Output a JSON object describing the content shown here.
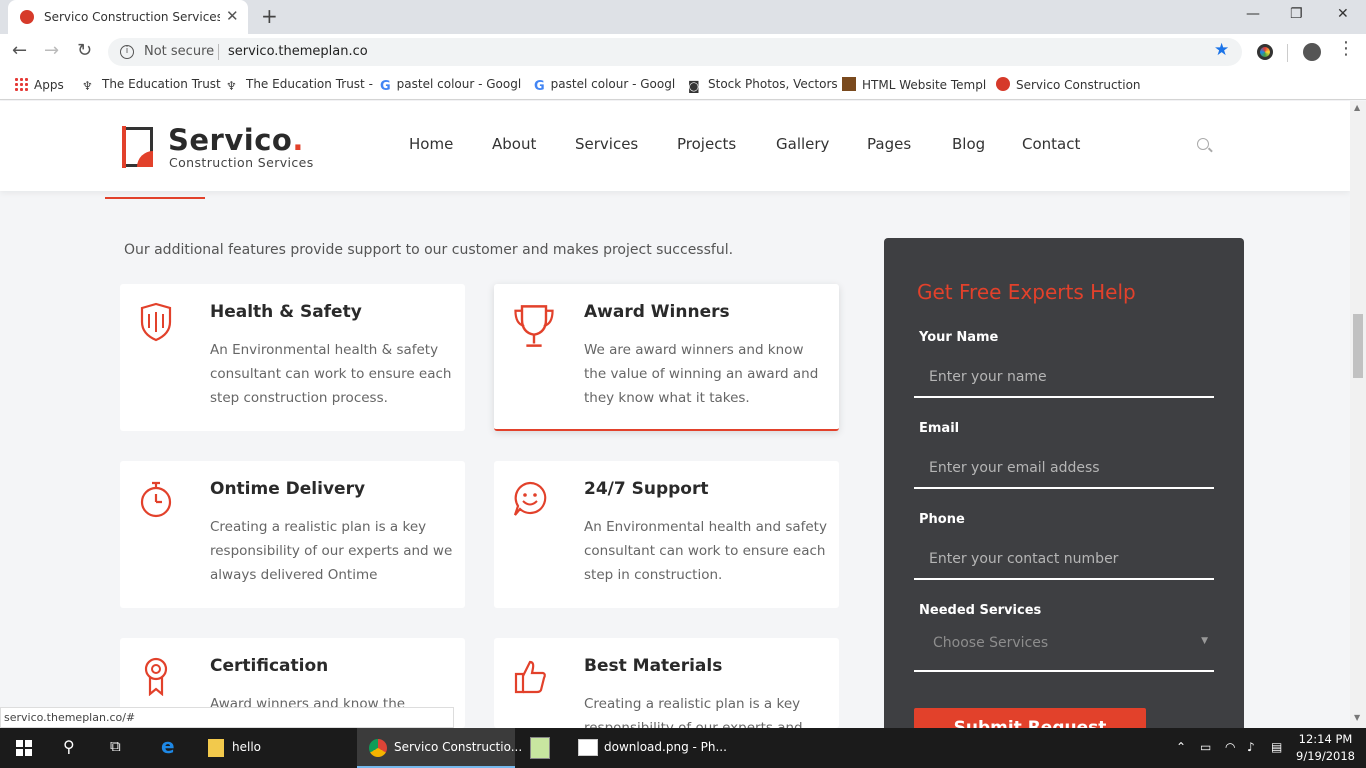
{
  "browser": {
    "tab_title": "Servico Construction Services Bo",
    "url": "servico.themeplan.co",
    "security_label": "Not secure",
    "bookmarks": [
      "Apps",
      "The Education Trust",
      "The Education Trust -",
      "pastel colour - Googl",
      "pastel colour - Googl",
      "Stock Photos, Vectors",
      "HTML Website Templ",
      "Servico Construction"
    ],
    "status_url": "servico.themeplan.co/#"
  },
  "site": {
    "logo_name": "Servico",
    "logo_dot": ".",
    "logo_sub": "Construction Services",
    "nav": [
      "Home",
      "About",
      "Services",
      "Projects",
      "Gallery",
      "Pages",
      "Blog",
      "Contact"
    ],
    "accent_color": "#e2412b"
  },
  "features": {
    "intro": "Our additional features provide support to our customer and makes project successful.",
    "cards": [
      {
        "title": "Health & Safety",
        "text": "An Environmental health & safety consultant can work to ensure each step construction process.",
        "icon": "shield-icon"
      },
      {
        "title": "Award Winners",
        "text": "We are award winners and know the value of winning an award and they know what it takes.",
        "icon": "trophy-icon"
      },
      {
        "title": "Ontime Delivery",
        "text": "Creating a realistic plan is a key responsibility of our experts and we always delivered Ontime",
        "icon": "stopwatch-icon"
      },
      {
        "title": "24/7 Support",
        "text": "An Environmental health and safety consultant can work to ensure each step in construction.",
        "icon": "smiley-chat-icon"
      },
      {
        "title": "Certification",
        "text": "Award winners and know the",
        "icon": "ribbon-medal-icon"
      },
      {
        "title": "Best Materials",
        "text": "Creating a realistic plan is a key responsibility of our experts and",
        "icon": "thumbs-up-icon"
      }
    ]
  },
  "form": {
    "title": "Get Free Experts Help",
    "name_label": "Your Name",
    "name_placeholder": "Enter your name",
    "email_label": "Email",
    "email_placeholder": "Enter your email addess",
    "phone_label": "Phone",
    "phone_placeholder": "Enter your contact number",
    "services_label": "Needed Services",
    "services_selected": "Choose Services",
    "submit_label": "Submit Request"
  },
  "taskbar": {
    "items": [
      "hello",
      "Servico Constructio...",
      "download.png - Ph..."
    ],
    "time": "12:14 PM",
    "date": "9/19/2018"
  }
}
